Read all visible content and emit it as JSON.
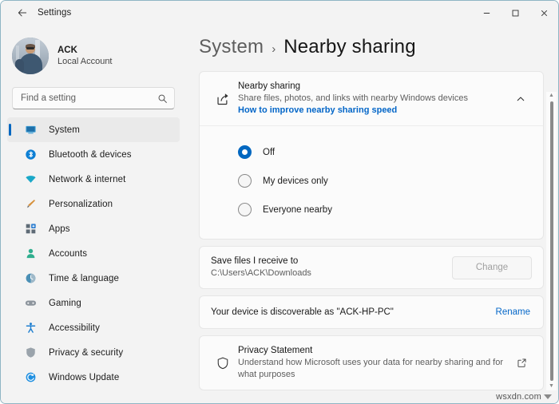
{
  "window": {
    "title": "Settings",
    "back_icon": "back-arrow-icon",
    "controls": {
      "minimize": "minimize-icon",
      "maximize": "maximize-icon",
      "close": "close-icon"
    }
  },
  "sidebar": {
    "account": {
      "name": "ACK",
      "type": "Local Account",
      "avatar": "user-avatar-photo"
    },
    "search": {
      "placeholder": "Find a setting",
      "value": "",
      "icon": "search-icon"
    },
    "items": [
      {
        "label": "System",
        "icon": "monitor-icon",
        "active": true
      },
      {
        "label": "Bluetooth & devices",
        "icon": "bluetooth-icon",
        "active": false
      },
      {
        "label": "Network & internet",
        "icon": "wifi-icon",
        "active": false
      },
      {
        "label": "Personalization",
        "icon": "paintbrush-icon",
        "active": false
      },
      {
        "label": "Apps",
        "icon": "apps-icon",
        "active": false
      },
      {
        "label": "Accounts",
        "icon": "person-icon",
        "active": false
      },
      {
        "label": "Time & language",
        "icon": "clock-globe-icon",
        "active": false
      },
      {
        "label": "Gaming",
        "icon": "gamepad-icon",
        "active": false
      },
      {
        "label": "Accessibility",
        "icon": "accessibility-icon",
        "active": false
      },
      {
        "label": "Privacy & security",
        "icon": "shield-icon",
        "active": false
      },
      {
        "label": "Windows Update",
        "icon": "update-icon",
        "active": false
      }
    ]
  },
  "breadcrumb": {
    "parent": "System",
    "separator": "›",
    "current": "Nearby sharing"
  },
  "cards": {
    "nearby_sharing": {
      "icon": "share-icon",
      "title": "Nearby sharing",
      "subtitle": "Share files, photos, and links with nearby Windows devices",
      "link": "How to improve nearby sharing speed",
      "expand_icon": "chevron-up-icon",
      "options": [
        {
          "label": "Off",
          "selected": true
        },
        {
          "label": "My devices only",
          "selected": false
        },
        {
          "label": "Everyone nearby",
          "selected": false
        }
      ]
    },
    "save_location": {
      "title": "Save files I receive to",
      "path": "C:\\Users\\ACK\\Downloads",
      "button_label": "Change",
      "button_disabled": true
    },
    "device_name": {
      "text": "Your device is discoverable as \"ACK-HP-PC\"",
      "action_label": "Rename"
    },
    "privacy": {
      "icon": "shield-outline-icon",
      "title": "Privacy Statement",
      "subtitle": "Understand how Microsoft uses your data for nearby sharing and for what purposes",
      "external_icon": "external-link-icon"
    }
  },
  "scrollbar": {
    "up_arrow": "▲",
    "down_arrow": "▼"
  },
  "watermark": {
    "text": "wsxdn.com"
  },
  "colors": {
    "accent": "#0067c0",
    "link": "#0366c8",
    "window_bg": "#f3f3f3",
    "card_bg": "#fbfbfb"
  }
}
